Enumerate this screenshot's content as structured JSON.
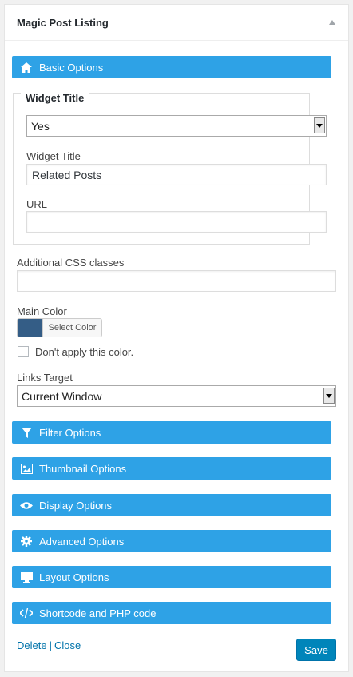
{
  "widget": {
    "title": "Magic Post Listing"
  },
  "sections": {
    "basic": {
      "label": "Basic Options",
      "icon": "home-icon"
    },
    "filter": {
      "label": "Filter Options",
      "icon": "filter-icon"
    },
    "thumbnail": {
      "label": "Thumbnail Options",
      "icon": "image-icon"
    },
    "display": {
      "label": "Display Options",
      "icon": "eye-icon"
    },
    "advanced": {
      "label": "Advanced Options",
      "icon": "gear-icon"
    },
    "layout": {
      "label": "Layout Options",
      "icon": "monitor-icon"
    },
    "shortcode": {
      "label": "Shortcode and PHP code",
      "icon": "code-icon"
    }
  },
  "basic": {
    "group_legend": "Widget Title",
    "title_mode_select": "Yes",
    "widget_title_label": "Widget Title",
    "widget_title_value": "Related Posts",
    "url_label": "URL",
    "url_value": "",
    "css_label": "Additional CSS classes",
    "css_value": "",
    "main_color_label": "Main Color",
    "main_color_hex": "#345d86",
    "select_color_button": "Select Color",
    "dont_apply_label": "Don't apply this color.",
    "dont_apply_checked": false,
    "links_target_label": "Links Target",
    "links_target_value": "Current Window"
  },
  "footer": {
    "delete_label": "Delete",
    "separator": "|",
    "close_label": "Close",
    "save_label": "Save"
  },
  "colors": {
    "accent": "#2ea2e6",
    "save_button": "#0085ba",
    "link": "#0073aa"
  }
}
